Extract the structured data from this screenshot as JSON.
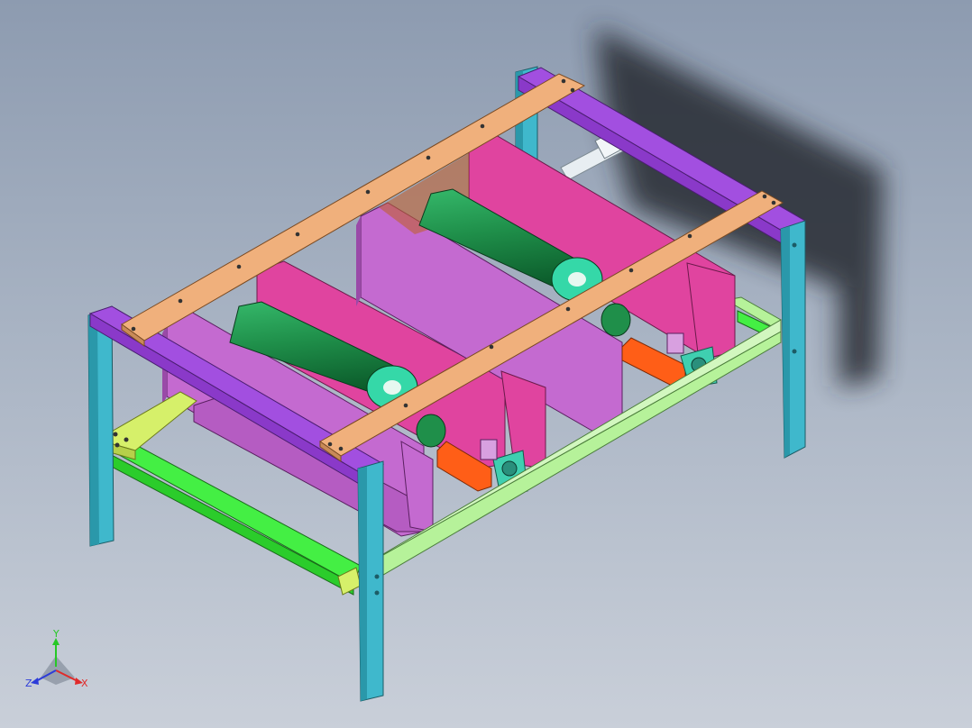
{
  "viewport": {
    "background_top": "#8d9bb0",
    "background_bottom": "#c9cfd9"
  },
  "model": {
    "colors": {
      "legs": "#3fb8cc",
      "top_rails": "#a24fe0",
      "top_straps": "#f0b07c",
      "side_panels": "#e0449f",
      "inner_panels": "#c46ad0",
      "rollers": "#1f8f4a",
      "roller_caps": "#35d8a8",
      "bottom_frame": "#b6f29a",
      "bottom_frame_side": "#44ef44",
      "bottom_crossbar": "#d6f06a",
      "motor_plates": "#ff5e17",
      "bearing_blocks": "#3fcfb0",
      "shaft": "#e8eef2",
      "shadow": "#262a30"
    }
  },
  "triad": {
    "y": "Y",
    "x": "X",
    "z": "Z",
    "y_color": "#26c826",
    "x_color": "#e02a2a",
    "z_color": "#2d3cd8"
  }
}
